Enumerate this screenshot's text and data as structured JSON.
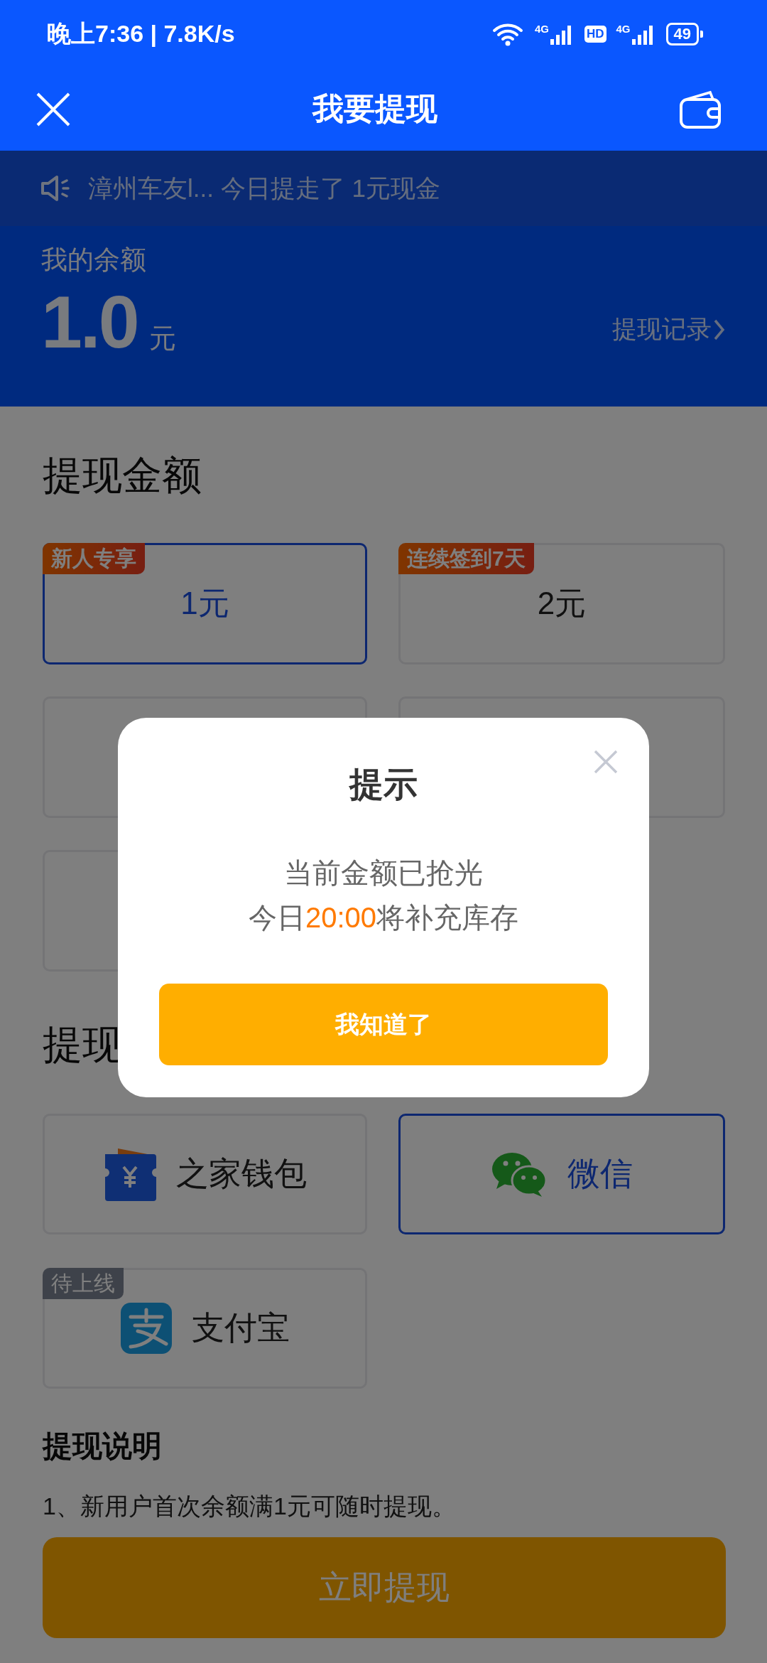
{
  "status_bar": {
    "time": "晚上7:36 | 7.8K/s",
    "network_1": "4G",
    "hd": "HD",
    "network_2": "4G",
    "battery": "49"
  },
  "header": {
    "title": "我要提现"
  },
  "notice": {
    "text": "漳州车友l... 今日提走了 1元现金"
  },
  "balance": {
    "label": "我的余额",
    "amount": "1.0",
    "unit": "元",
    "history_link": "提现记录"
  },
  "amount_section": {
    "title": "提现金额",
    "options": [
      {
        "kind": "amount",
        "label": "1元",
        "badge": "新人专享",
        "selected": true
      },
      {
        "kind": "amount",
        "label": "2元",
        "badge": "连续签到7天",
        "selected": false
      },
      {
        "kind": "covered"
      },
      {
        "kind": "covered"
      },
      {
        "kind": "covered"
      }
    ]
  },
  "payment_section": {
    "title": "提现",
    "methods": [
      {
        "kind": "wallet",
        "label": "之家钱包",
        "selected": false
      },
      {
        "kind": "wechat",
        "label": "微信",
        "selected": true
      },
      {
        "kind": "alipay",
        "label": "支付宝",
        "selected": false,
        "badge": "待上线"
      }
    ]
  },
  "notes": {
    "title": "提现说明",
    "lines": [
      "1、新用户首次余额满1元可随时提现。"
    ]
  },
  "submit_button": {
    "label": "立即提现"
  },
  "dialog": {
    "title": "提示",
    "message_lines": [
      [
        {
          "text": "当前金额已抢光",
          "highlight": false
        }
      ],
      [
        {
          "text": "今日",
          "highlight": false
        },
        {
          "text": "20:00",
          "highlight": true
        },
        {
          "text": "将补充库存",
          "highlight": false
        }
      ]
    ],
    "button": "我知道了"
  }
}
